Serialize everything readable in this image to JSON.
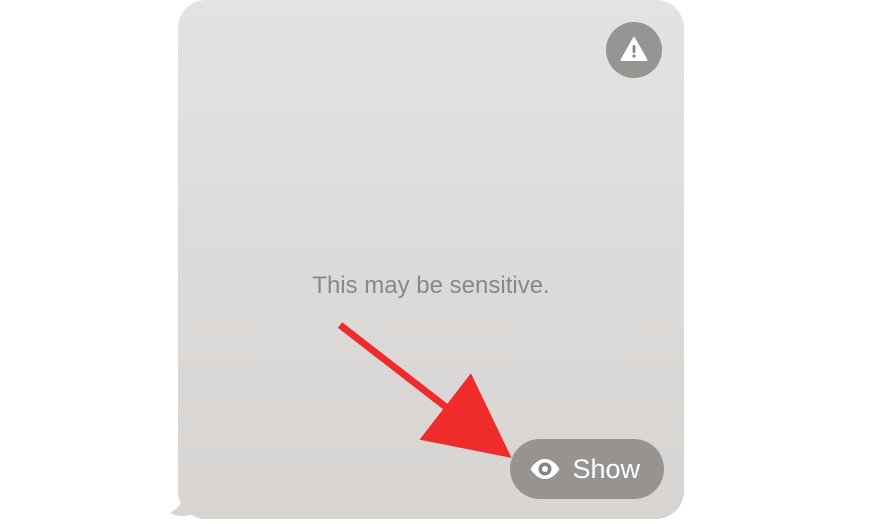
{
  "message": {
    "sensitive_text": "This may be sensitive.",
    "show_button_label": "Show"
  }
}
